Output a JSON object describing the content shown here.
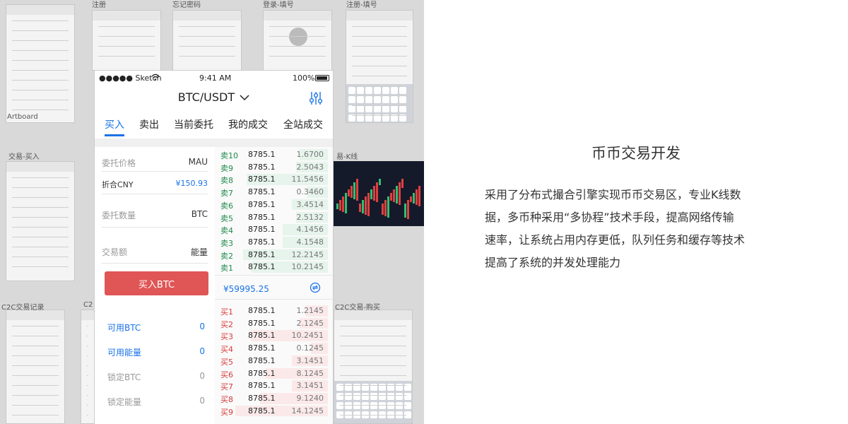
{
  "collage": {
    "board_titles": [
      "注册",
      "忘记密码",
      "登录-填号",
      "注册-填号",
      "Artboard",
      "交易-买入",
      "易-K线",
      "C2C交易记录",
      "C2",
      "C2C交易-购买"
    ]
  },
  "phone": {
    "status_bar": {
      "carrier": "●●●●● Sketch",
      "time": "9:41 AM",
      "battery": "100%"
    },
    "pair_title": "BTC/USDT",
    "tabs": [
      {
        "label": "买入",
        "active": true
      },
      {
        "label": "卖出",
        "active": false
      },
      {
        "label": "当前委托",
        "active": false
      },
      {
        "label": "我的成交",
        "active": false
      },
      {
        "label": "全站成交",
        "active": false
      }
    ],
    "form": {
      "price_label": "委托价格",
      "price_unit": "MAU",
      "cny_label": "折合CNY",
      "cny_value": "¥150.93",
      "amount_label": "委托数量",
      "amount_unit": "BTC",
      "total_label": "交易额",
      "total_unit": "能量",
      "buy_button": "买入BTC"
    },
    "balances": [
      {
        "label": "可用BTC",
        "value": "0",
        "style": "blue"
      },
      {
        "label": "可用能量",
        "value": "0",
        "style": "blue"
      },
      {
        "label": "锁定BTC",
        "value": "0",
        "style": "gray"
      },
      {
        "label": "锁定能量",
        "value": "0",
        "style": "gray"
      }
    ],
    "order_book": {
      "asks": [
        {
          "label": "卖10",
          "price": "8785.1",
          "qty": "1.6700",
          "depth": 0.25
        },
        {
          "label": "卖9",
          "price": "8785.1",
          "qty": "2.5043",
          "depth": 0.28
        },
        {
          "label": "卖8",
          "price": "8785.1",
          "qty": "11.5456",
          "depth": 0.72
        },
        {
          "label": "卖7",
          "price": "8785.1",
          "qty": "0.3460",
          "depth": 0.18
        },
        {
          "label": "卖6",
          "price": "8785.1",
          "qty": "3.4514",
          "depth": 0.32
        },
        {
          "label": "卖5",
          "price": "8785.1",
          "qty": "2.5132",
          "depth": 0.28
        },
        {
          "label": "卖4",
          "price": "8785.1",
          "qty": "4.1456",
          "depth": 0.4
        },
        {
          "label": "卖3",
          "price": "8785.1",
          "qty": "4.1548",
          "depth": 0.4
        },
        {
          "label": "卖2",
          "price": "8785.1",
          "qty": "12.2145",
          "depth": 0.75
        },
        {
          "label": "卖1",
          "price": "8785.1",
          "qty": "10.2145",
          "depth": 0.68
        }
      ],
      "last_price": "¥59995.25",
      "bids": [
        {
          "label": "买1",
          "price": "8785.1",
          "qty": "1.2145",
          "depth": 0.2
        },
        {
          "label": "买2",
          "price": "8785.1",
          "qty": "2.1245",
          "depth": 0.25
        },
        {
          "label": "买3",
          "price": "8785.1",
          "qty": "10.2451",
          "depth": 0.68
        },
        {
          "label": "买4",
          "price": "8785.1",
          "qty": "0.1245",
          "depth": 0.15
        },
        {
          "label": "买5",
          "price": "8785.1",
          "qty": "3.1451",
          "depth": 0.32
        },
        {
          "label": "买6",
          "price": "8785.1",
          "qty": "8.1245",
          "depth": 0.55
        },
        {
          "label": "买7",
          "price": "8785.1",
          "qty": "3.1451",
          "depth": 0.32
        },
        {
          "label": "买8",
          "price": "8785.1",
          "qty": "9.1240",
          "depth": 0.6
        },
        {
          "label": "买9",
          "price": "8785.1",
          "qty": "14.1245",
          "depth": 0.82
        }
      ]
    }
  },
  "feature": {
    "title": "币币交易开发",
    "description_lines": [
      "采用了分布式撮合引擎实现币币交易区，专业K线数",
      "据，多币种采用“多协程”技术手段，提高网络传输",
      "速率，让系统占用内存更低，队列任务和缓存等技术",
      "提高了系统的并发处理能力"
    ]
  },
  "colors": {
    "accent_blue": "#1a73e8",
    "buy_red": "#e05555",
    "ask_green": "#1f8a4c",
    "bid_red": "#d83a3a"
  }
}
